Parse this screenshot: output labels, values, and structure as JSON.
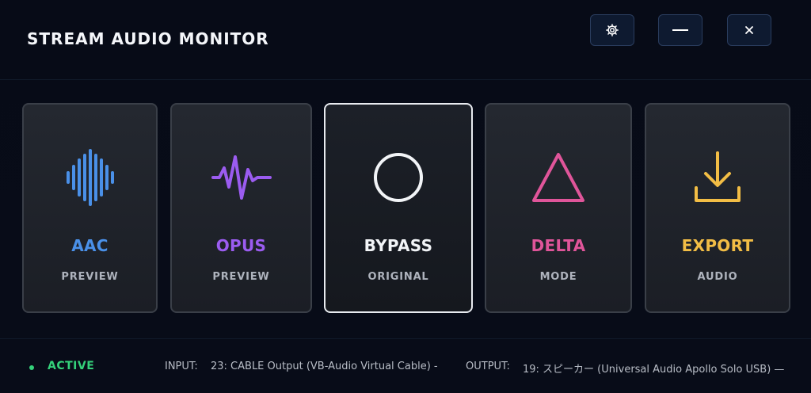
{
  "app": {
    "title": "STREAM AUDIO MONITOR"
  },
  "window_controls": {
    "settings_icon": "gear-icon",
    "minimize_icon": "minimize-icon",
    "close_icon": "close-icon"
  },
  "cards": [
    {
      "title": "AAC",
      "subtitle": "PREVIEW",
      "icon": "waveform-bars-icon",
      "color": "#4a90e8",
      "selected": false
    },
    {
      "title": "OPUS",
      "subtitle": "PREVIEW",
      "icon": "pulse-wave-icon",
      "color": "#9b5cf0",
      "selected": false
    },
    {
      "title": "BYPASS",
      "subtitle": "ORIGINAL",
      "icon": "circle-icon",
      "color": "#f2f4f7",
      "selected": true
    },
    {
      "title": "DELTA",
      "subtitle": "MODE",
      "icon": "triangle-icon",
      "color": "#e0559a",
      "selected": false
    },
    {
      "title": "EXPORT",
      "subtitle": "AUDIO",
      "icon": "download-icon",
      "color": "#f2bd45",
      "selected": false
    }
  ],
  "status": {
    "text": "ACTIVE",
    "color": "#34d17a"
  },
  "io": {
    "input_label": "INPUT:",
    "input_value": "23: CABLE Output (VB-Audio Virtual Cable) -",
    "output_label": "OUTPUT:",
    "output_value": "19: スピーカー (Universal Audio Apollo Solo USB) —"
  }
}
